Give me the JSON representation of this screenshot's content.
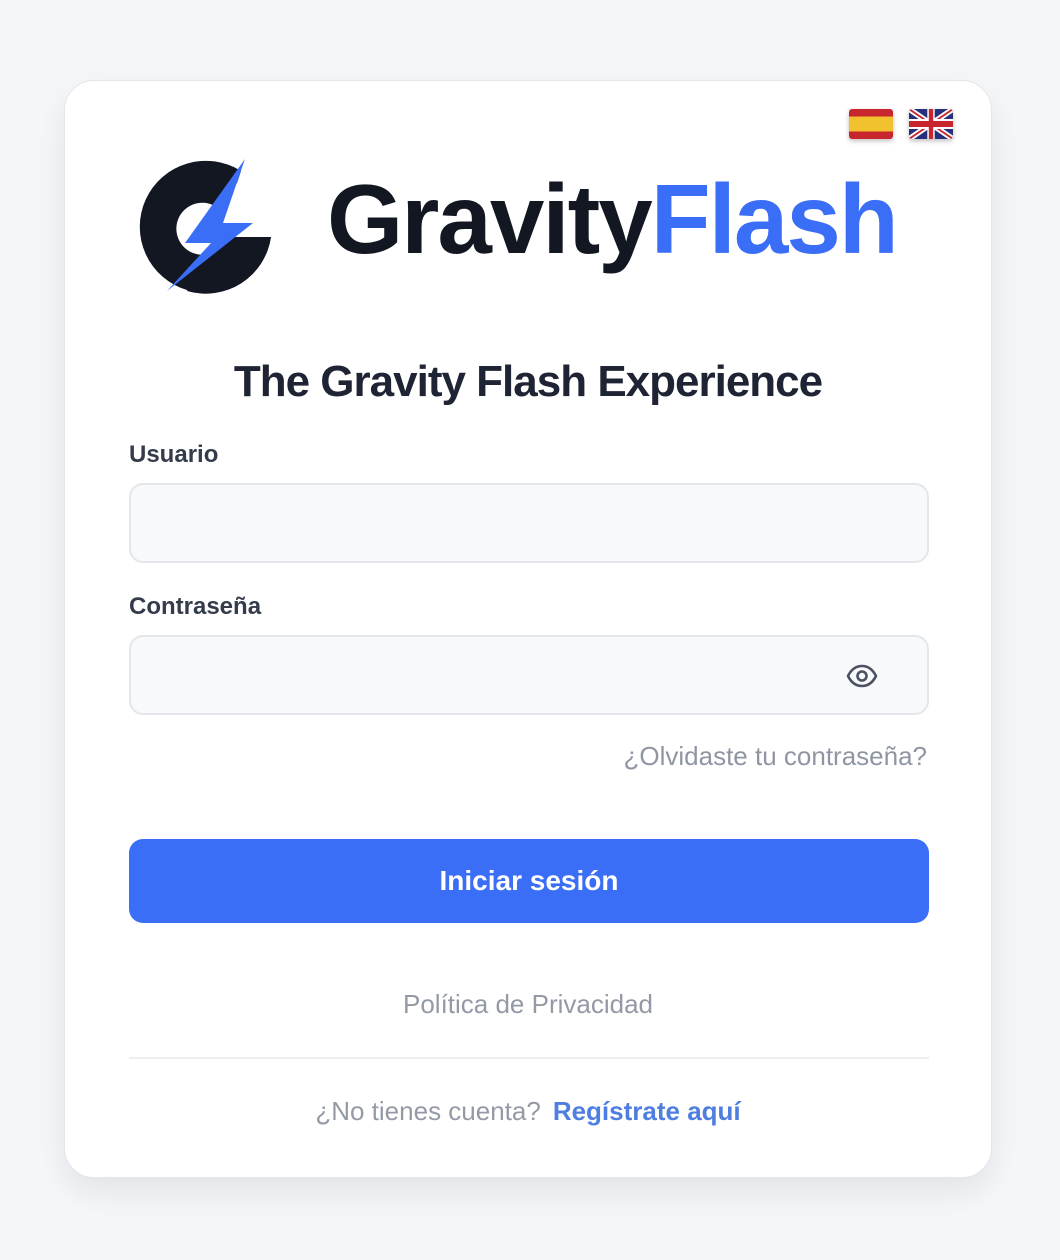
{
  "brand": {
    "name_part1": "Gravity",
    "name_part2": "Flash",
    "accent_color": "#3b6ef7",
    "dark_color": "#131722"
  },
  "languages": [
    {
      "code": "es",
      "icon": "spain-flag-icon"
    },
    {
      "code": "en",
      "icon": "uk-flag-icon"
    }
  ],
  "title": "The Gravity Flash Experience",
  "form": {
    "username_label": "Usuario",
    "username_value": "",
    "password_label": "Contraseña",
    "password_value": "",
    "show_password_icon": "eye-icon",
    "forgot_password": "¿Olvidaste tu contraseña?",
    "submit_label": "Iniciar sesión"
  },
  "footer": {
    "privacy": "Política de Privacidad",
    "register_question": "¿No tienes cuenta?",
    "register_link": "Regístrate aquí"
  }
}
